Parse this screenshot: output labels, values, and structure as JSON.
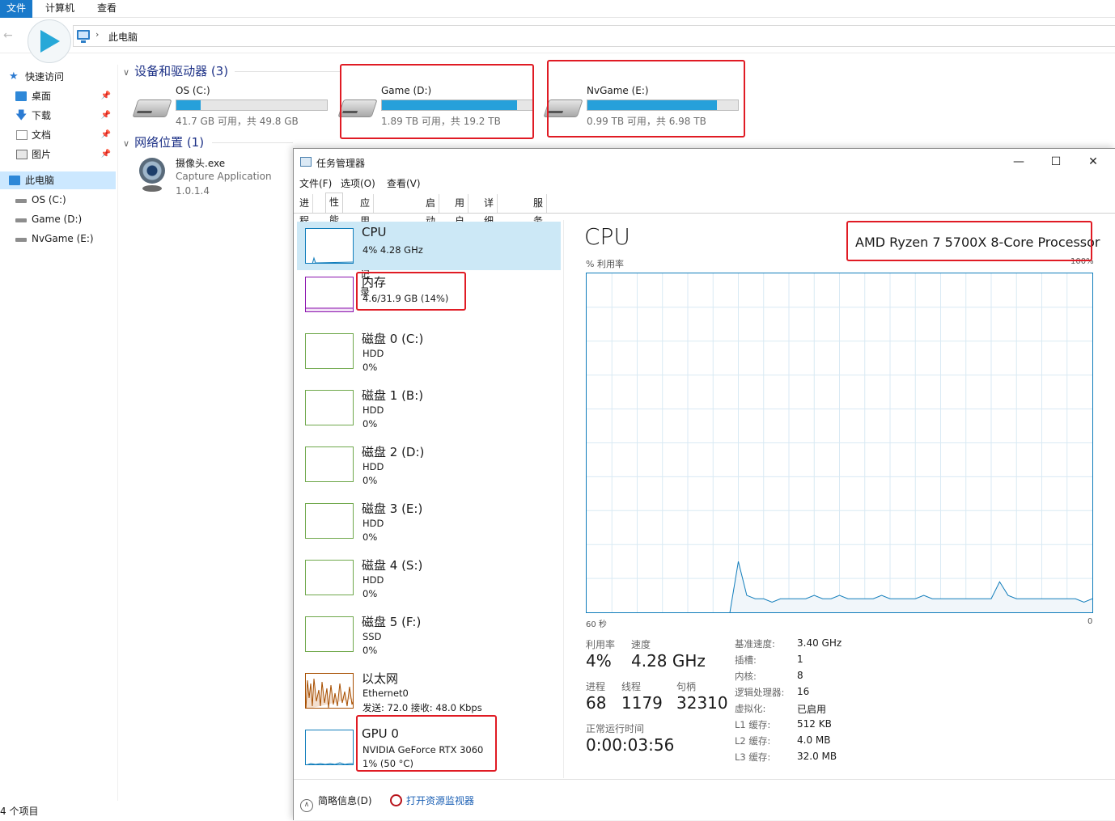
{
  "ribbon": {
    "tabs": [
      "文件",
      "计算机",
      "查看"
    ]
  },
  "address": {
    "path": "此电脑"
  },
  "nav": {
    "items": [
      {
        "label": "快速访问"
      },
      {
        "label": "桌面"
      },
      {
        "label": "下载"
      },
      {
        "label": "文档"
      },
      {
        "label": "图片"
      },
      {
        "label": "此电脑"
      },
      {
        "label": "OS (C:)"
      },
      {
        "label": "Game (D:)"
      },
      {
        "label": "NvGame (E:)"
      }
    ]
  },
  "devices": {
    "header": "设备和驱动器 (3)",
    "drives": [
      {
        "name": "OS (C:)",
        "free": "41.7 GB 可用，共 49.8 GB",
        "used_fraction": 0.16
      },
      {
        "name": "Game (D:)",
        "free": "1.89 TB 可用，共 19.2 TB",
        "used_fraction": 0.9
      },
      {
        "name": "NvGame (E:)",
        "free": "0.99 TB 可用，共 6.98 TB",
        "used_fraction": 0.86
      }
    ]
  },
  "network": {
    "header": "网络位置 (1)",
    "app": {
      "name": "摄像头.exe",
      "desc": "Capture Application",
      "version": "1.0.1.4"
    }
  },
  "status": {
    "count": "4 个项目"
  },
  "taskmgr": {
    "title": "任务管理器",
    "menus": [
      "文件(F)",
      "选项(O)",
      "查看(V)"
    ],
    "tabs": [
      "进程",
      "性能",
      "应用历史记录",
      "启动",
      "用户",
      "详细信息",
      "服务"
    ],
    "sidebar": [
      {
        "title": "CPU",
        "lines": [
          "4% 4.28 GHz"
        ]
      },
      {
        "title": "内存",
        "lines": [
          "4.6/31.9 GB (14%)"
        ]
      },
      {
        "title": "磁盘 0 (C:)",
        "lines": [
          "HDD",
          "0%"
        ]
      },
      {
        "title": "磁盘 1 (B:)",
        "lines": [
          "HDD",
          "0%"
        ]
      },
      {
        "title": "磁盘 2 (D:)",
        "lines": [
          "HDD",
          "0%"
        ]
      },
      {
        "title": "磁盘 3 (E:)",
        "lines": [
          "HDD",
          "0%"
        ]
      },
      {
        "title": "磁盘 4 (S:)",
        "lines": [
          "HDD",
          "0%"
        ]
      },
      {
        "title": "磁盘 5 (F:)",
        "lines": [
          "SSD",
          "0%"
        ]
      },
      {
        "title": "以太网",
        "lines": [
          "Ethernet0",
          "发送: 72.0 接收: 48.0 Kbps"
        ]
      },
      {
        "title": "GPU 0",
        "lines": [
          "NVIDIA GeForce RTX 3060",
          "1% (50 °C)"
        ]
      }
    ],
    "cpu": {
      "heading": "CPU",
      "model": "AMD Ryzen 7 5700X 8-Core Processor",
      "util_label": "% 利用率",
      "util_max": "100%",
      "time_left": "60 秒",
      "time_right": "0",
      "stats": {
        "util_label": "利用率",
        "util_value": "4%",
        "speed_label": "速度",
        "speed_value": "4.28 GHz",
        "proc_label": "进程",
        "proc_value": "68",
        "thread_label": "线程",
        "thread_value": "1179",
        "handle_label": "句柄",
        "handle_value": "32310",
        "uptime_label": "正常运行时间",
        "uptime_value": "0:00:03:56"
      },
      "specs": [
        {
          "k": "基准速度:",
          "v": "3.40 GHz"
        },
        {
          "k": "插槽:",
          "v": "1"
        },
        {
          "k": "内核:",
          "v": "8"
        },
        {
          "k": "逻辑处理器:",
          "v": "16"
        },
        {
          "k": "虚拟化:",
          "v": "已启用"
        },
        {
          "k": "L1 缓存:",
          "v": "512 KB"
        },
        {
          "k": "L2 缓存:",
          "v": "4.0 MB"
        },
        {
          "k": "L3 缓存:",
          "v": "32.0 MB"
        }
      ]
    },
    "footer": {
      "fewer": "简略信息(D)",
      "resmon": "打开资源监视器"
    }
  },
  "chart_data": {
    "type": "area",
    "title": "",
    "xlabel": "",
    "ylabel": "% 利用率",
    "x_range_label": [
      "60 秒",
      "0"
    ],
    "ylim": [
      0,
      100
    ],
    "grid": true,
    "series": [
      {
        "color": "#117dbb",
        "values": [
          0,
          0,
          0,
          0,
          0,
          0,
          0,
          0,
          0,
          0,
          0,
          0,
          0,
          0,
          0,
          0,
          0,
          0,
          15,
          5,
          4,
          4,
          3,
          4,
          4,
          4,
          4,
          5,
          4,
          4,
          5,
          4,
          4,
          4,
          4,
          5,
          4,
          4,
          4,
          4,
          5,
          4,
          4,
          4,
          4,
          4,
          4,
          4,
          4,
          9,
          5,
          4,
          4,
          4,
          4,
          4,
          4,
          4,
          4,
          3,
          4
        ]
      }
    ]
  }
}
